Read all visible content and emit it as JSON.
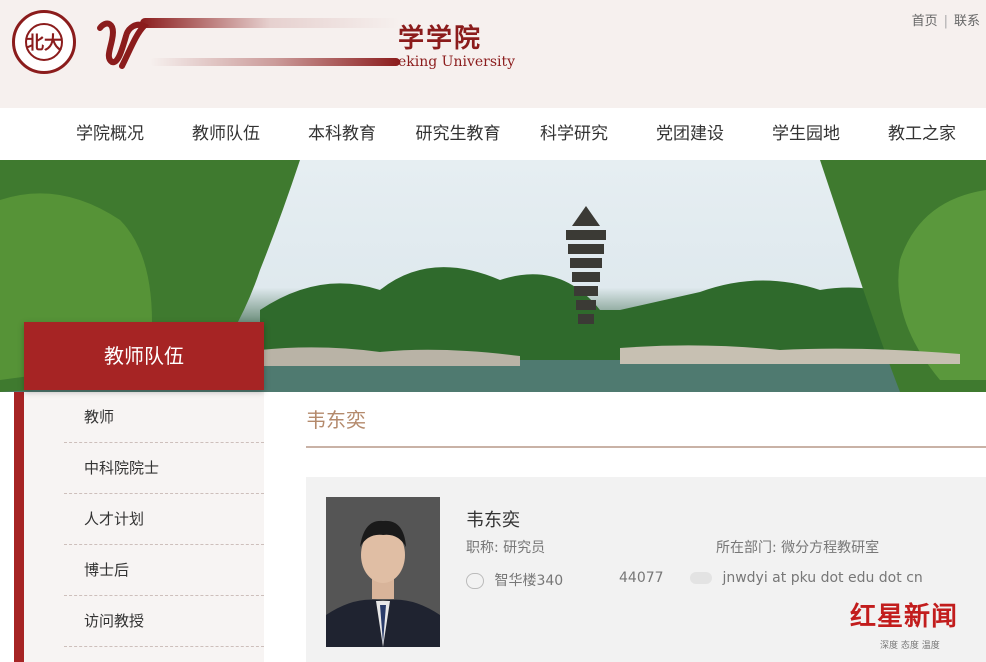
{
  "header": {
    "school_name": "学学院",
    "school_name_en": "eking University",
    "top_links": [
      "首页",
      "联系"
    ],
    "seal_text": "北大"
  },
  "nav": {
    "items": [
      "学院概况",
      "教师队伍",
      "本科教育",
      "研究生教育",
      "科学研究",
      "党团建设",
      "学生园地",
      "教工之家"
    ]
  },
  "sidebar": {
    "title": "教师队伍",
    "items": [
      "教师",
      "中科院院士",
      "人才计划",
      "博士后",
      "访问教授"
    ]
  },
  "content": {
    "title": "韦东奕",
    "person": {
      "name": "韦东奕",
      "title_label": "职称:",
      "title_value": "研究员",
      "dept_label": "所在部门:",
      "dept_value": "微分方程教研室",
      "office": "智华楼340",
      "phone": "44077",
      "email": "jnwdyi at pku dot edu dot cn"
    }
  },
  "watermark": {
    "main": "红星新闻",
    "sub": "深度 态度 温度"
  },
  "colors": {
    "brand_red": "#a62424",
    "accent_tan": "#b48a6c"
  }
}
